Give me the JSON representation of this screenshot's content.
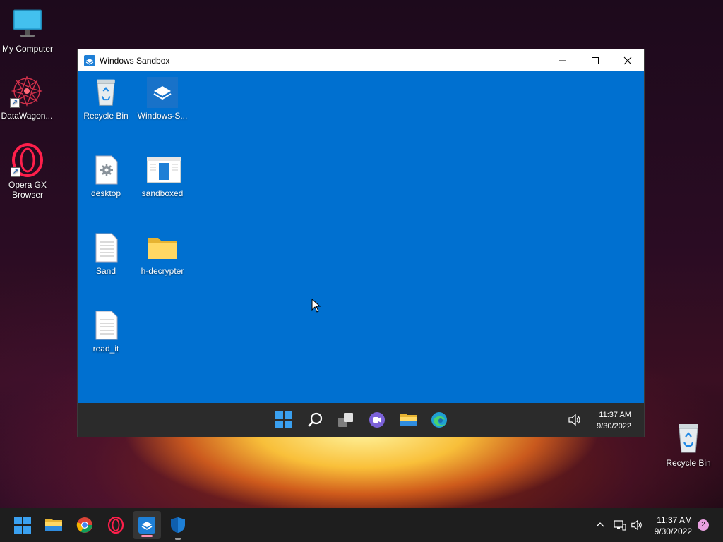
{
  "desktop": {
    "icons": [
      {
        "label": "My Computer",
        "icon": "monitor-icon"
      },
      {
        "label": "DataWagon...",
        "icon": "datawagon-icon"
      },
      {
        "label": "Opera GX Browser",
        "icon": "opera-gx-icon"
      },
      {
        "label": "Recycle Bin",
        "icon": "recycle-bin-icon"
      }
    ]
  },
  "sandbox_window": {
    "title": "Windows Sandbox",
    "desktop_icons": [
      {
        "label": "Recycle Bin",
        "icon": "recycle-bin-icon"
      },
      {
        "label": "Windows-S...",
        "icon": "windows-sandbox-icon"
      },
      {
        "label": "desktop",
        "icon": "settings-file-icon"
      },
      {
        "label": "sandboxed",
        "icon": "app-window-icon"
      },
      {
        "label": "Sand",
        "icon": "text-file-icon"
      },
      {
        "label": "h-decrypter",
        "icon": "folder-icon"
      },
      {
        "label": "read_it",
        "icon": "text-file-icon"
      }
    ],
    "taskbar": {
      "apps": [
        "start-icon",
        "search-icon",
        "task-view-icon",
        "teams-chat-icon",
        "file-explorer-icon",
        "edge-icon"
      ],
      "time": "11:37 AM",
      "date": "9/30/2022"
    }
  },
  "taskbar": {
    "apps": [
      "start-icon",
      "file-explorer-icon",
      "chrome-icon",
      "opera-gx-icon",
      "windows-sandbox-icon",
      "windows-security-icon"
    ],
    "time": "11:37 AM",
    "date": "9/30/2022",
    "notification_count": "2"
  },
  "colors": {
    "sandbox_desktop": "#0070d0",
    "taskbar": "#1e1e1e",
    "sandbox_taskbar": "#2b2b2b",
    "active_indicator": "#ff8fb0"
  }
}
